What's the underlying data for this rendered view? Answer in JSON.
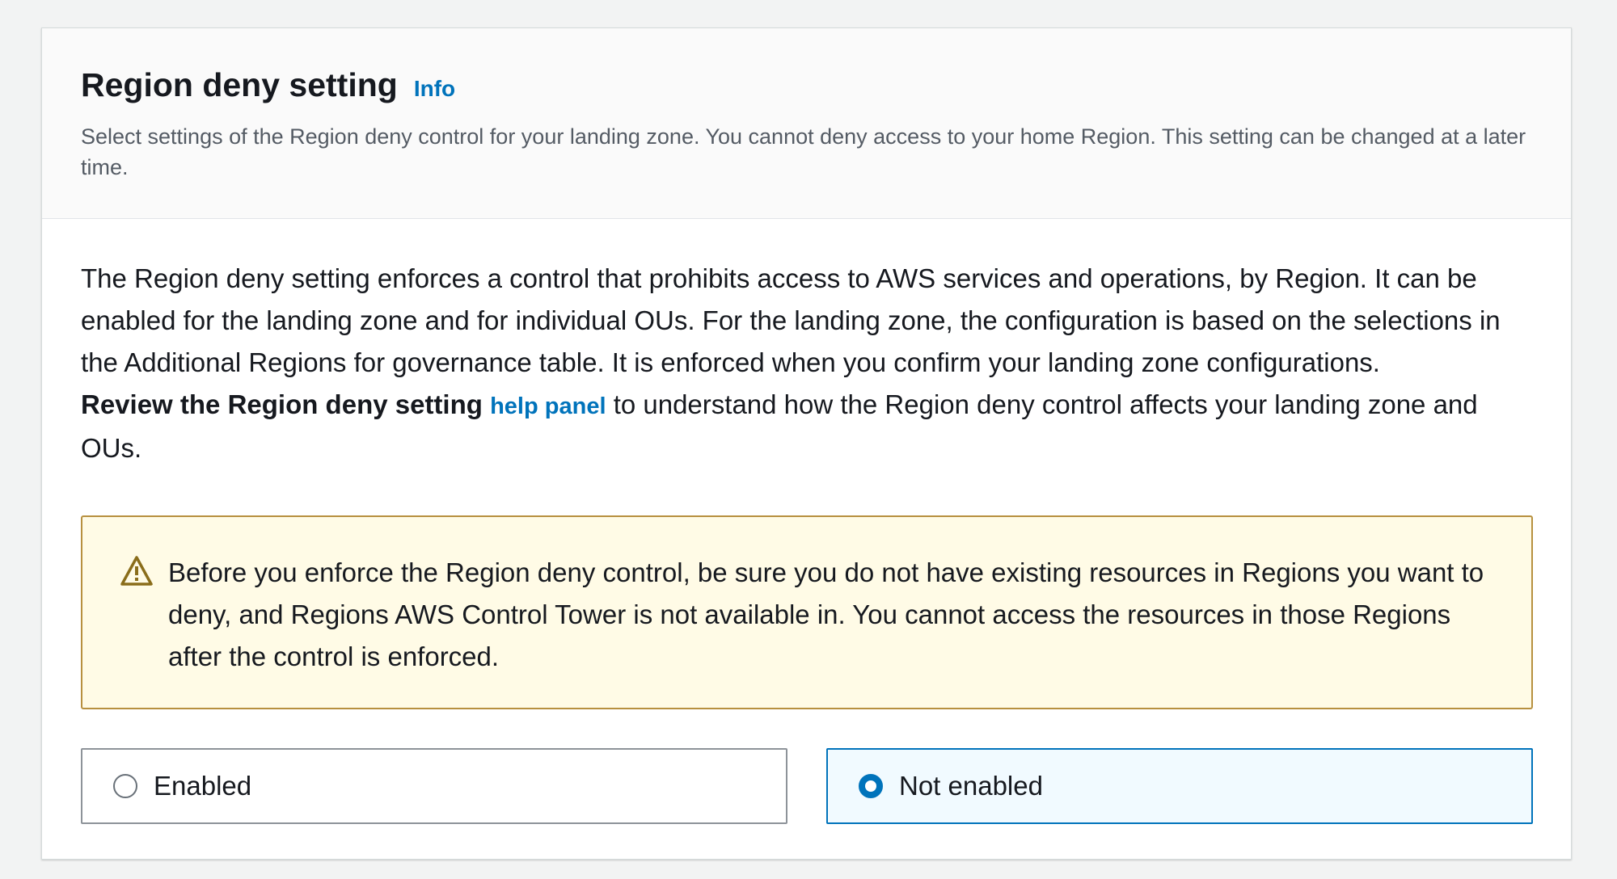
{
  "section": {
    "title": "Region deny setting",
    "info_link": "Info",
    "description": "Select settings of the Region deny control for your landing zone. You cannot deny access to your home Region. This setting can be changed at a later time."
  },
  "body": {
    "paragraph": "The Region deny setting enforces a control that prohibits access to AWS services and operations, by Region. It can be enabled for the landing zone and for individual OUs. For the landing zone, the configuration is based on the selections in the Additional Regions for governance table. It is enforced when you confirm your landing zone configurations.",
    "review_bold": "Review the Region deny setting",
    "help_link": "help panel",
    "review_rest": "to understand how the Region deny control affects your landing zone and OUs."
  },
  "warning": {
    "icon": "warning-icon",
    "text": "Before you enforce the Region deny control, be sure you do not have existing resources in Regions you want to deny, and Regions AWS Control Tower is not available in. You cannot access the resources in those Regions after the control is enforced."
  },
  "options": [
    {
      "label": "Enabled",
      "selected": false
    },
    {
      "label": "Not enabled",
      "selected": true
    }
  ],
  "colors": {
    "link": "#0073bb",
    "warning_border": "#b7903f",
    "warning_bg": "#fffbe6",
    "selected_bg": "#f1faff"
  }
}
